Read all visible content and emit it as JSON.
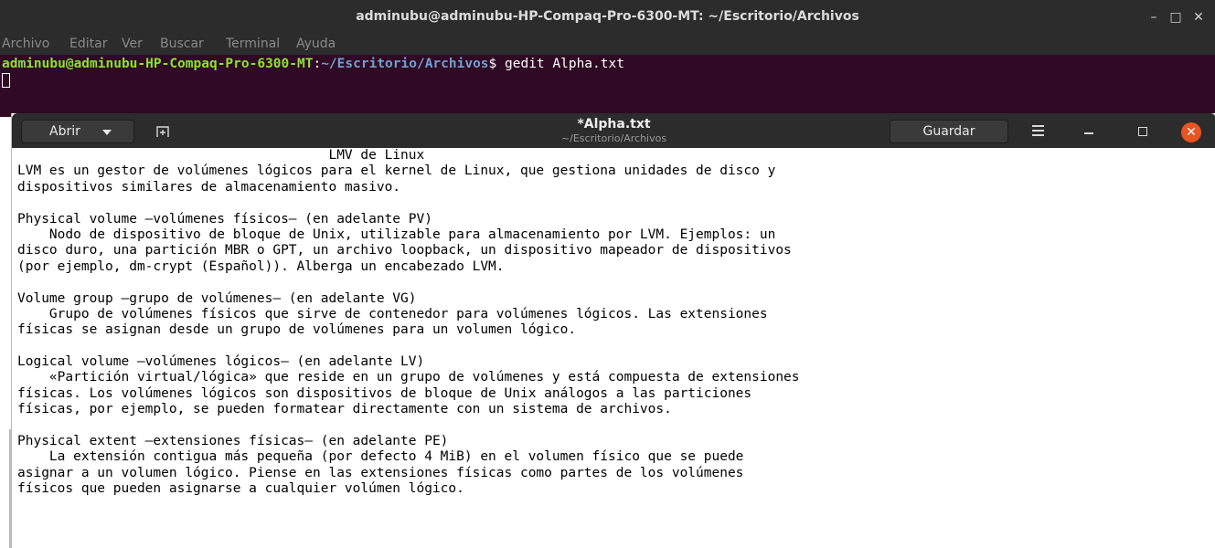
{
  "terminal": {
    "title": "adminubu@adminubu-HP-Compaq-Pro-6300-MT: ~/Escritorio/Archivos",
    "controls": {
      "minimize": "–",
      "maximize": "□",
      "close": "✕"
    },
    "menu": [
      "Archivo",
      "Editar",
      "Ver",
      "Buscar",
      "Terminal",
      "Ayuda"
    ],
    "prompt_user": "adminubu@adminubu-HP-Compaq-Pro-6300-MT",
    "prompt_sep": ":",
    "prompt_path": "~/Escritorio/Archivos",
    "prompt_end": "$ ",
    "command": "gedit Alpha.txt",
    "colors": {
      "background": "#300a24",
      "user": "#8ae234",
      "path": "#729fcf"
    }
  },
  "gedit": {
    "open_label": "Abrir",
    "new_tab_icon": "new-tab-icon",
    "title": "*Alpha.txt",
    "subtitle": "~/Escritorio/Archivos",
    "save_label": "Guardar",
    "close_glyph": "✕",
    "accent_color": "#e95420",
    "lines": [
      "                                       LMV de Linux",
      "LVM es un gestor de volúmenes lógicos para el kernel de Linux, que gestiona unidades de disco y",
      "dispositivos similares de almacenamiento masivo.",
      "",
      "Physical volume —volúmenes físicos— (en adelante PV)",
      "    Nodo de dispositivo de bloque de Unix, utilizable para almacenamiento por LVM. Ejemplos: un",
      "disco duro, una partición MBR o GPT, un archivo loopback, un dispositivo mapeador de dispositivos",
      "(por ejemplo, dm-crypt (Español)). Alberga un encabezado LVM.",
      "",
      "Volume group —grupo de volúmenes— (en adelante VG)",
      "    Grupo de volúmenes físicos que sirve de contenedor para volúmenes lógicos. Las extensiones",
      "físicas se asignan desde un grupo de volúmenes para un volumen lógico.",
      "",
      "Logical volume —volúmenes lógicos— (en adelante LV)",
      "    «Partición virtual/lógica» que reside en un grupo de volúmenes y está compuesta de extensiones",
      "físicas. Los volúmenes lógicos son dispositivos de bloque de Unix análogos a las particiones",
      "físicas, por ejemplo, se pueden formatear directamente con un sistema de archivos.",
      "",
      "Physical extent —extensiones físicas— (en adelante PE)",
      "    La extensión contigua más pequeña (por defecto 4 MiB) en el volumen físico que se puede",
      "asignar a un volumen lógico. Piense en las extensiones físicas como partes de los volúmenes",
      "físicos que pueden asignarse a cualquier volúmen lógico."
    ]
  }
}
